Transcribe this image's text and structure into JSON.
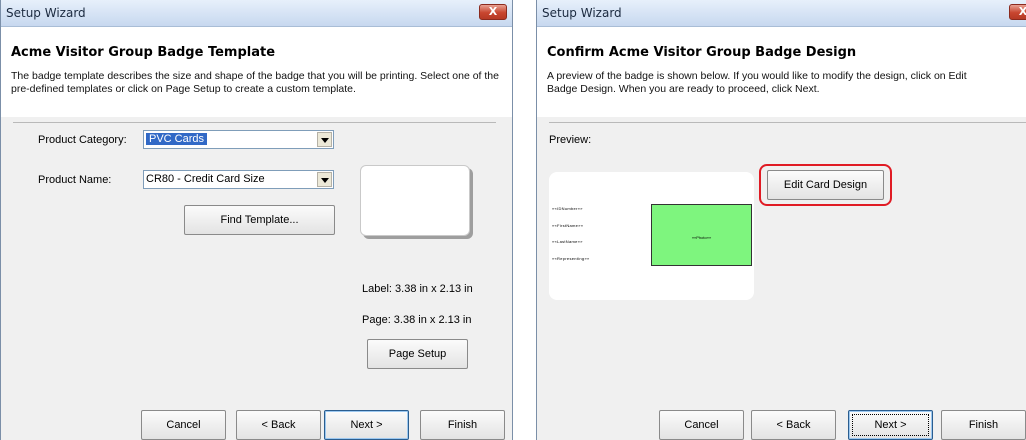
{
  "window_left": {
    "title": "Setup Wizard",
    "close_label": "X",
    "heading": "Acme Visitor Group Badge Template",
    "description": "The badge template describes the size and shape of the badge that you will be printing. Select one of the pre-defined templates or click on Page Setup to create a custom template.",
    "product_category_label": "Product Category:",
    "product_category_value": "PVC Cards",
    "product_name_label": "Product Name:",
    "product_name_value": "CR80 - Credit Card Size",
    "find_template_label": "Find Template...",
    "label_size": "Label: 3.38 in x 2.13 in",
    "page_size": "Page: 3.38 in x 2.13 in",
    "page_setup_label": "Page Setup",
    "buttons": {
      "cancel": "Cancel",
      "back": "< Back",
      "next": "Next >",
      "finish": "Finish"
    }
  },
  "window_right": {
    "title": "Setup Wizard",
    "close_label": "X",
    "heading": "Confirm Acme Visitor Group Badge Design",
    "description": "A preview of the badge is shown below. If you would like to modify the design, click on Edit Badge Design. When you are ready to proceed, click Next.",
    "preview_label": "Preview:",
    "edit_card_design_label": "Edit Card Design",
    "badge_fields": [
      "««IDNumber»»",
      "««FirstName»»",
      "««LastName»»",
      "««Representing»»"
    ],
    "photo_label": "««Photo»»",
    "photo_color": "#7ef57e",
    "highlight_color": "#e01b24",
    "buttons": {
      "cancel": "Cancel",
      "back": "< Back",
      "next": "Next >",
      "finish": "Finish"
    }
  }
}
